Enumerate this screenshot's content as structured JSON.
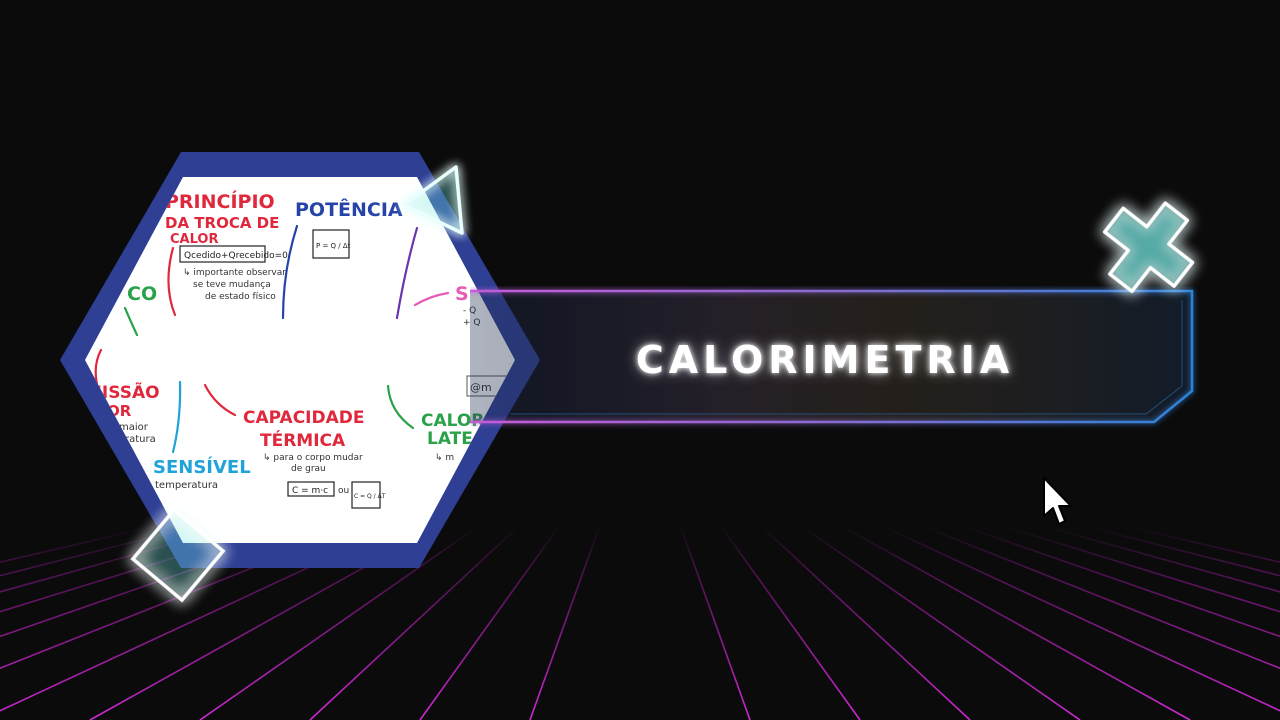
{
  "slide": {
    "title": "CALORIMETRIA"
  },
  "mindmap": {
    "center_word": "calorimetria",
    "nodes": {
      "principio": "PRINCÍPIO",
      "troca": "DA TROCA DE",
      "calor": "CALOR",
      "equation_box": "Qcedido+Qrecebido=0",
      "note1": "↳ importante observar",
      "note2": "se teve mudança",
      "note3": "de estado físico",
      "potencia": "POTÊNCIA",
      "potencia_formula": "P = Q / Δt",
      "co": "CO",
      "missao": "MISSÃO",
      "or": "OR",
      "maior": "maior",
      "ratura": "ratura",
      "capacidade": "CAPACIDADE",
      "termica": "TÉRMICA",
      "cap_note1": "↳ para o corpo mudar",
      "cap_note2": "de grau",
      "cap_formula1": "C = m·c",
      "ou": "ou",
      "cap_formula2": "C = Q / ΔT",
      "sensivel": "SENSÍVEL",
      "temperatura": "temperatura",
      "s_head": "S",
      "s_minus": "- Q",
      "s_plus": "+ Q",
      "handle": "@m",
      "calor_latente1": "CALOR",
      "calor_latente2": "LATE",
      "calor_latente_note": "↳ m"
    }
  },
  "colors": {
    "background": "#0b0b0c",
    "grid": "#c31ec8",
    "hex_border": "#2e3f94",
    "neon_cyan": "#6fe6e0",
    "banner_edge_blue": "#2d82d6",
    "banner_edge_pink": "#c55bd8"
  },
  "decorations": {
    "triangle": "triangle-outline-icon",
    "cross": "cross-icon",
    "diamond": "square-outline-icon",
    "cursor": "pointer-cursor-icon"
  }
}
